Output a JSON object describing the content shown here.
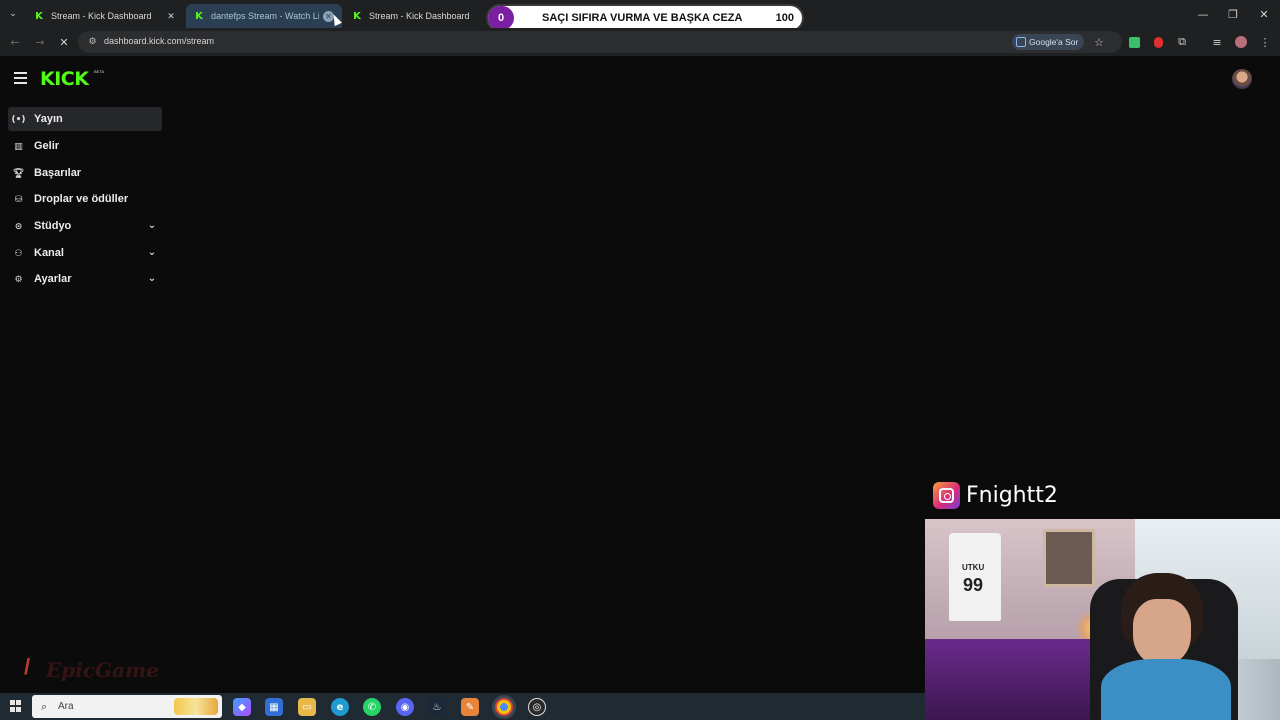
{
  "browser": {
    "tabs": [
      {
        "title": "Stream - Kick Dashboard"
      },
      {
        "title": "dantefps Stream - Watch Live o"
      },
      {
        "title": "Stream - Kick Dashboard"
      }
    ],
    "url": "dashboard.kick.com/stream",
    "google_ask": "Google'a Sor"
  },
  "poll": {
    "left_count": "0",
    "text": "SAÇI SIFIRA VURMA VE BAŞKA CEZA",
    "right_count": "100"
  },
  "app": {
    "logo": "KICK",
    "logo_badge": "BETA"
  },
  "sidebar": {
    "items": [
      {
        "label": "Yayın",
        "icon": "broadcast-icon",
        "active": true
      },
      {
        "label": "Gelir",
        "icon": "chart-icon"
      },
      {
        "label": "Başarılar",
        "icon": "trophy-icon"
      },
      {
        "label": "Droplar ve ödüller",
        "icon": "gift-icon"
      },
      {
        "label": "Stüdyo",
        "icon": "studio-icon",
        "expandable": true
      },
      {
        "label": "Kanal",
        "icon": "channel-icon",
        "expandable": true
      },
      {
        "label": "Ayarlar",
        "icon": "gear-icon",
        "expandable": true
      }
    ]
  },
  "overlay": {
    "instagram_handle": "Fnightt2",
    "watermark": "EpicGame"
  },
  "taskbar": {
    "search_placeholder": "Ara"
  },
  "colors": {
    "kick_green": "#53fc18",
    "page_bg": "#0b0b0c",
    "poll_purple": "#7a1fa2"
  }
}
